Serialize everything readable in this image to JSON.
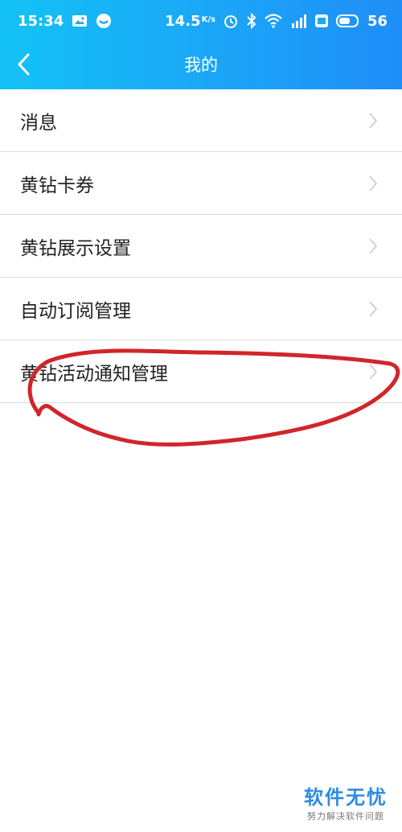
{
  "status_bar": {
    "time": "15:34",
    "speed": "14.5",
    "speed_unit": "K/s",
    "battery": "56",
    "icons": [
      "image-notification-icon",
      "app-notification-icon",
      "alarm-icon",
      "bluetooth-icon",
      "wifi-icon",
      "signal-4g-icon",
      "hd-icon",
      "battery-icon"
    ]
  },
  "nav": {
    "title": "我的",
    "back_icon": "chevron-left-icon"
  },
  "menu": {
    "items": [
      {
        "label": "消息"
      },
      {
        "label": "黄钻卡券"
      },
      {
        "label": "黄钻展示设置"
      },
      {
        "label": "自动订阅管理"
      },
      {
        "label": "黄钻活动通知管理"
      }
    ]
  },
  "watermark": {
    "title": "软件无忧",
    "subtitle": "努力解决软件问题"
  },
  "colors": {
    "header_start": "#13c2f6",
    "header_end": "#1f8ef8",
    "annotation": "#d0262a"
  }
}
